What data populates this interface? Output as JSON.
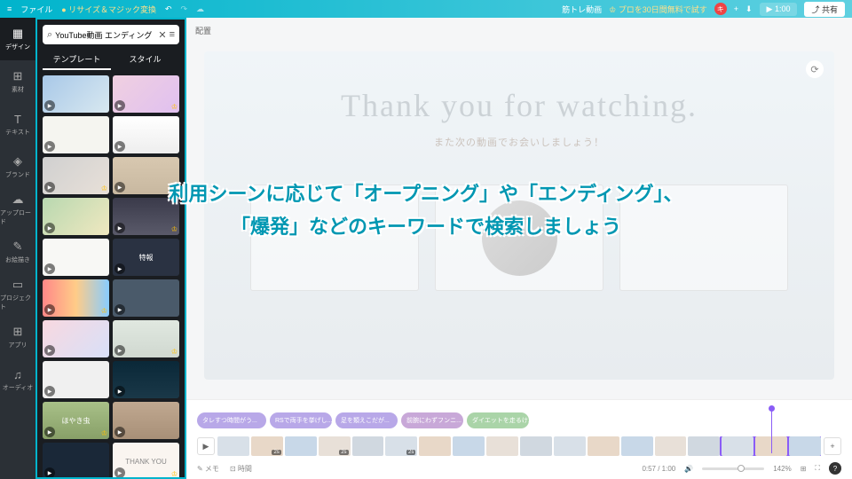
{
  "topbar": {
    "menu": "≡",
    "file": "ファイル",
    "resize": "● リサイズ＆マジック変換",
    "title": "筋トレ動画",
    "trial": "♔ プロを30日間無料で試す",
    "avatar": "キ",
    "plus": "+",
    "time": "▶ 1:00",
    "share": "⤴ 共有"
  },
  "narrow": [
    {
      "icon": "▦",
      "label": "デザイン",
      "active": true
    },
    {
      "icon": "⊞",
      "label": "素材"
    },
    {
      "icon": "T",
      "label": "テキスト"
    },
    {
      "icon": "◈",
      "label": "ブランド"
    },
    {
      "icon": "☁",
      "label": "アップロード"
    },
    {
      "icon": "✎",
      "label": "お絵描き"
    },
    {
      "icon": "▭",
      "label": "プロジェクト"
    },
    {
      "icon": "⊞",
      "label": "アプリ"
    },
    {
      "icon": "♫",
      "label": "オーディオ"
    }
  ],
  "panel": {
    "search_value": "YouTube動画 エンディング",
    "tab_templates": "テンプレート",
    "tab_styles": "スタイル",
    "templates": [
      {
        "bg": "linear-gradient(135deg,#a8c8e8,#d8e8f0)"
      },
      {
        "bg": "linear-gradient(135deg,#f0d0e0,#e0c0f0)"
      },
      {
        "bg": "#f5f5f0"
      },
      {
        "bg": "linear-gradient(#fff,#eee)"
      },
      {
        "bg": "linear-gradient(135deg,#d0d0d0,#e8e0d8)"
      },
      {
        "bg": "linear-gradient(#d8c8b0,#c8b8a0)"
      },
      {
        "bg": "linear-gradient(135deg,#b8d8b0,#f0e8c0)"
      },
      {
        "bg": "linear-gradient(#3a3a4a,#5a5a6a)"
      },
      {
        "bg": "#f8f8f5"
      },
      {
        "bg": "#2a3242",
        "text": "特報",
        "tc": "#fff"
      },
      {
        "bg": "linear-gradient(90deg,#f88,#fc8,#8cf)"
      },
      {
        "bg": "#4a5a6a"
      },
      {
        "bg": "linear-gradient(135deg,#f8d8e0,#d8e0f8)"
      },
      {
        "bg": "linear-gradient(#e0e8e0,#d0d8d0)"
      },
      {
        "bg": "#f0f0f0"
      },
      {
        "bg": "linear-gradient(#0a2838,#1a3848)"
      },
      {
        "bg": "linear-gradient(#a8c088,#88a068)",
        "text": "ほやき虫",
        "tc": "#fff"
      },
      {
        "bg": "linear-gradient(#c0a890,#a89078)"
      },
      {
        "bg": "#1a2838"
      },
      {
        "bg": "#faf5f0",
        "text": "THANK YOU",
        "tc": "#888"
      }
    ]
  },
  "toolbar": {
    "arrange": "配置"
  },
  "canvas": {
    "title": "Thank you for watching.",
    "subtitle": "また次の動画でお会いしましょう！"
  },
  "clips": [
    "タレすつ時間がう...",
    "RSで両手を挙げし...",
    "足を類えこだが...",
    "前腕にわずフンニ...",
    "ダイエットを走るけ..."
  ],
  "frames": [
    "",
    "2s",
    "",
    "2s",
    "",
    "2s",
    "",
    "",
    "",
    "",
    "",
    "",
    "",
    "",
    "",
    "",
    "",
    ""
  ],
  "bottom": {
    "memo": "✎ メモ",
    "duration": "⊡ 時間",
    "time": "0:57 / 1:00",
    "zoom": "142%"
  },
  "overlay": {
    "l1": "利用シーンに応じて「オープニング」や「エンディング」、",
    "l2": "「爆発」などのキーワードで検索しましょう"
  }
}
